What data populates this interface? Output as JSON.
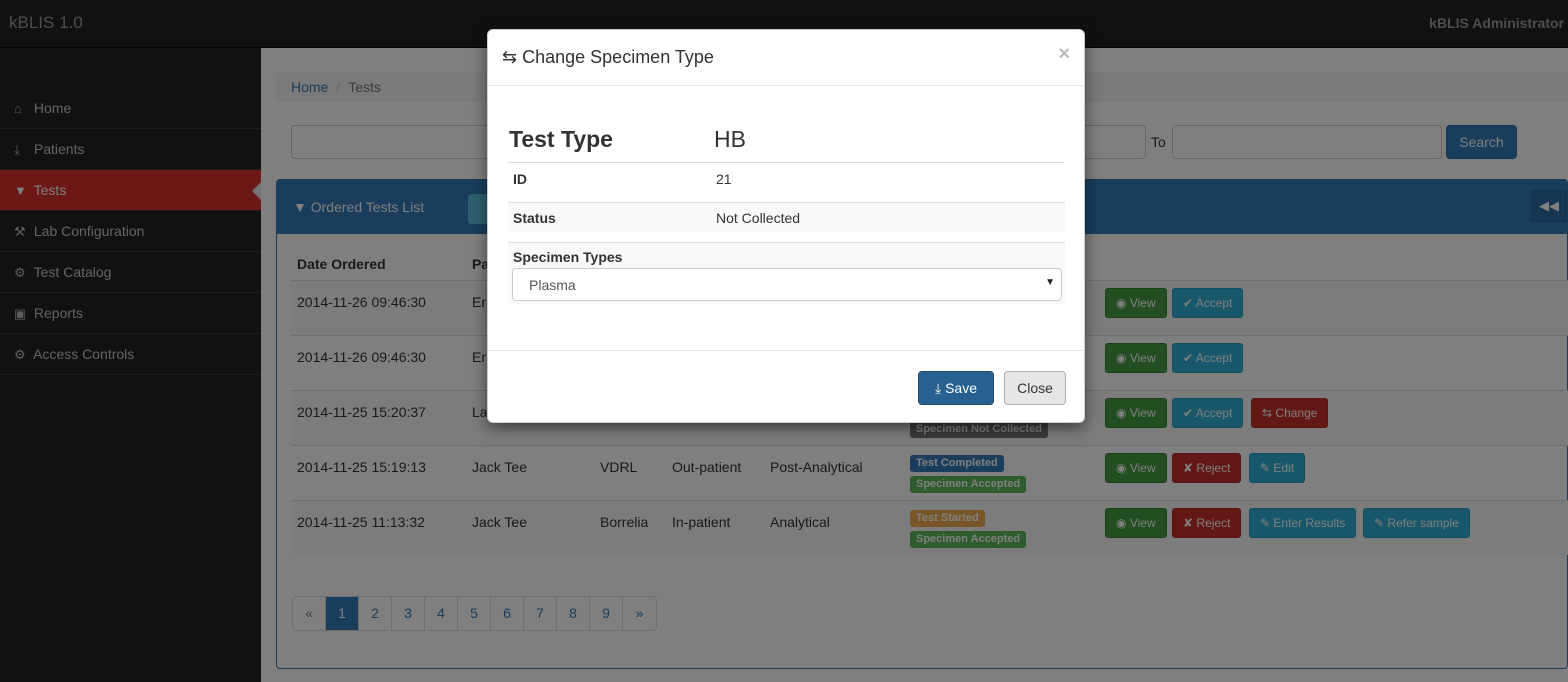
{
  "app": {
    "brand": "kBLIS 1.0",
    "user": "kBLIS Administrator"
  },
  "sidebar": {
    "items": [
      {
        "label": "Home",
        "icon": "home-icon"
      },
      {
        "label": "Patients",
        "icon": "download-icon"
      },
      {
        "label": "Tests",
        "icon": "filter-icon",
        "active": true
      },
      {
        "label": "Lab Configuration",
        "icon": "wrench-icon"
      },
      {
        "label": "Test Catalog",
        "icon": "cog-icon"
      },
      {
        "label": "Reports",
        "icon": "stats-icon"
      },
      {
        "label": "Access Controls",
        "icon": "cog-icon"
      }
    ]
  },
  "breadcrumb": {
    "home": "Home",
    "current": "Tests"
  },
  "filters": {
    "to_label": "To",
    "search_label": "Search"
  },
  "panel": {
    "title": "Ordered Tests List",
    "collapse_icon": "backward-icon"
  },
  "table": {
    "header_date": "Date Ordered",
    "header_patient": "Pa",
    "rows": [
      {
        "date": "2014-11-26 09:46:30",
        "patient": "Er",
        "test": "",
        "visit": "",
        "stage": "",
        "statuses": [],
        "actions": [
          "View",
          "Accept"
        ]
      },
      {
        "date": "2014-11-26 09:46:30",
        "patient": "Er",
        "test": "",
        "visit": "",
        "stage": "",
        "statuses": [],
        "actions": [
          "View",
          "Accept"
        ]
      },
      {
        "date": "2014-11-25 15:20:37",
        "patient": "La",
        "test": "",
        "visit": "",
        "stage": "",
        "statuses": [
          "Specimen Not Collected"
        ],
        "actions": [
          "View",
          "Accept",
          "Change"
        ]
      },
      {
        "date": "2014-11-25 15:19:13",
        "patient": "Jack Tee",
        "test": "VDRL",
        "visit": "Out-patient",
        "stage": "Post-Analytical",
        "statuses": [
          "Test Completed",
          "Specimen Accepted"
        ],
        "actions": [
          "View",
          "Reject",
          "Edit"
        ]
      },
      {
        "date": "2014-11-25 11:13:32",
        "patient": "Jack Tee",
        "test": "Borrelia",
        "visit": "In-patient",
        "stage": "Analytical",
        "statuses": [
          "Test Started",
          "Specimen Accepted"
        ],
        "actions": [
          "View",
          "Reject",
          "Enter Results",
          "Refer sample"
        ]
      }
    ]
  },
  "pagination": {
    "prev": "«",
    "pages": [
      "1",
      "2",
      "3",
      "4",
      "5",
      "6",
      "7",
      "8",
      "9"
    ],
    "next": "»",
    "current": "1"
  },
  "modal": {
    "title": "Change Specimen Type",
    "close_glyph": "×",
    "test_type_label": "Test Type",
    "test_type_value": "HB",
    "id_label": "ID",
    "id_value": "21",
    "status_label": "Status",
    "status_value": "Not Collected",
    "specimen_types_label": "Specimen Types",
    "specimen_types_selected": "Plasma",
    "save_label": "Save",
    "close_label": "Close"
  },
  "colors": {
    "accent": "#337ab7",
    "danger": "#d9302c",
    "success": "#449d44",
    "info": "#31b0d5"
  }
}
